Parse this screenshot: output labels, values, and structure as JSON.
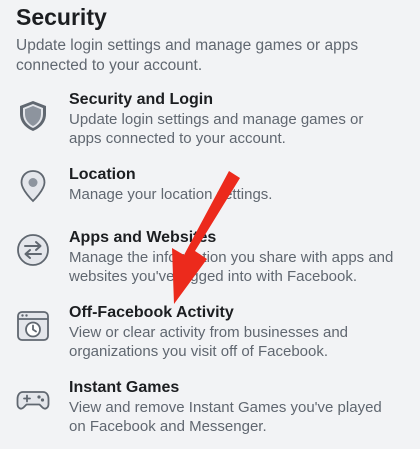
{
  "section": {
    "title": "Security",
    "description": "Update login settings and manage games or apps connected to your account."
  },
  "items": [
    {
      "title": "Security and Login",
      "description": "Update login settings and manage games or apps connected to your account.",
      "icon": "shield-icon"
    },
    {
      "title": "Location",
      "description": "Manage your location settings.",
      "icon": "location-pin-icon"
    },
    {
      "title": "Apps and Websites",
      "description": "Manage the information you share with apps and websites you've logged into with Facebook.",
      "icon": "apps-websites-icon"
    },
    {
      "title": "Off-Facebook Activity",
      "description": "View or clear activity from businesses and organizations you visit off of Facebook.",
      "icon": "activity-history-icon"
    },
    {
      "title": "Instant Games",
      "description": "View and remove Instant Games you've played on Facebook and Messenger.",
      "icon": "game-controller-icon"
    }
  ],
  "colors": {
    "background": "#f2f3f5",
    "title_text": "#1c1e21",
    "secondary_text": "#606770",
    "icon_gray": "#8d949e",
    "annotation_arrow": "#ec2a1c"
  }
}
